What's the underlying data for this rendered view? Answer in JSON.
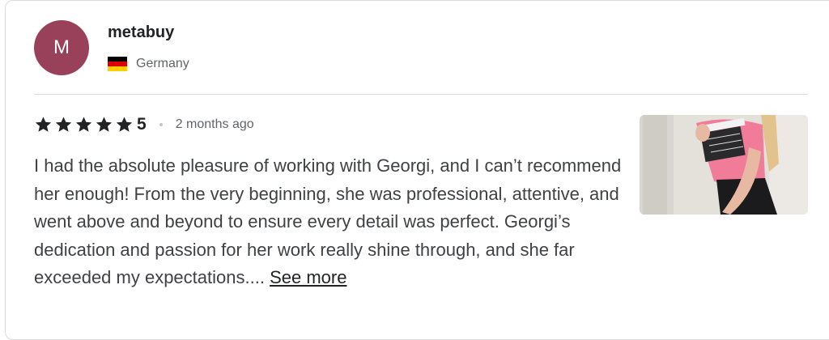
{
  "reviewer": {
    "avatar_initial": "M",
    "avatar_color": "#99405a",
    "name": "metabuy",
    "country": "Germany",
    "flag_icon": "germany-flag-icon"
  },
  "review": {
    "rating": "5",
    "star_count": 5,
    "time_ago": "2 months ago",
    "text": "I had the absolute pleasure of working with Georgi, and I can’t recommend her enough! From the very beginning, she was professional, attentive, and went above and beyond to ensure every detail was perfect. Georgi’s dedication and passion for her work really shine through, and she far exceeded my expectations....",
    "see_more_label": "See more"
  },
  "thumbnail": {
    "icon": "review-photo-thumbnail"
  }
}
